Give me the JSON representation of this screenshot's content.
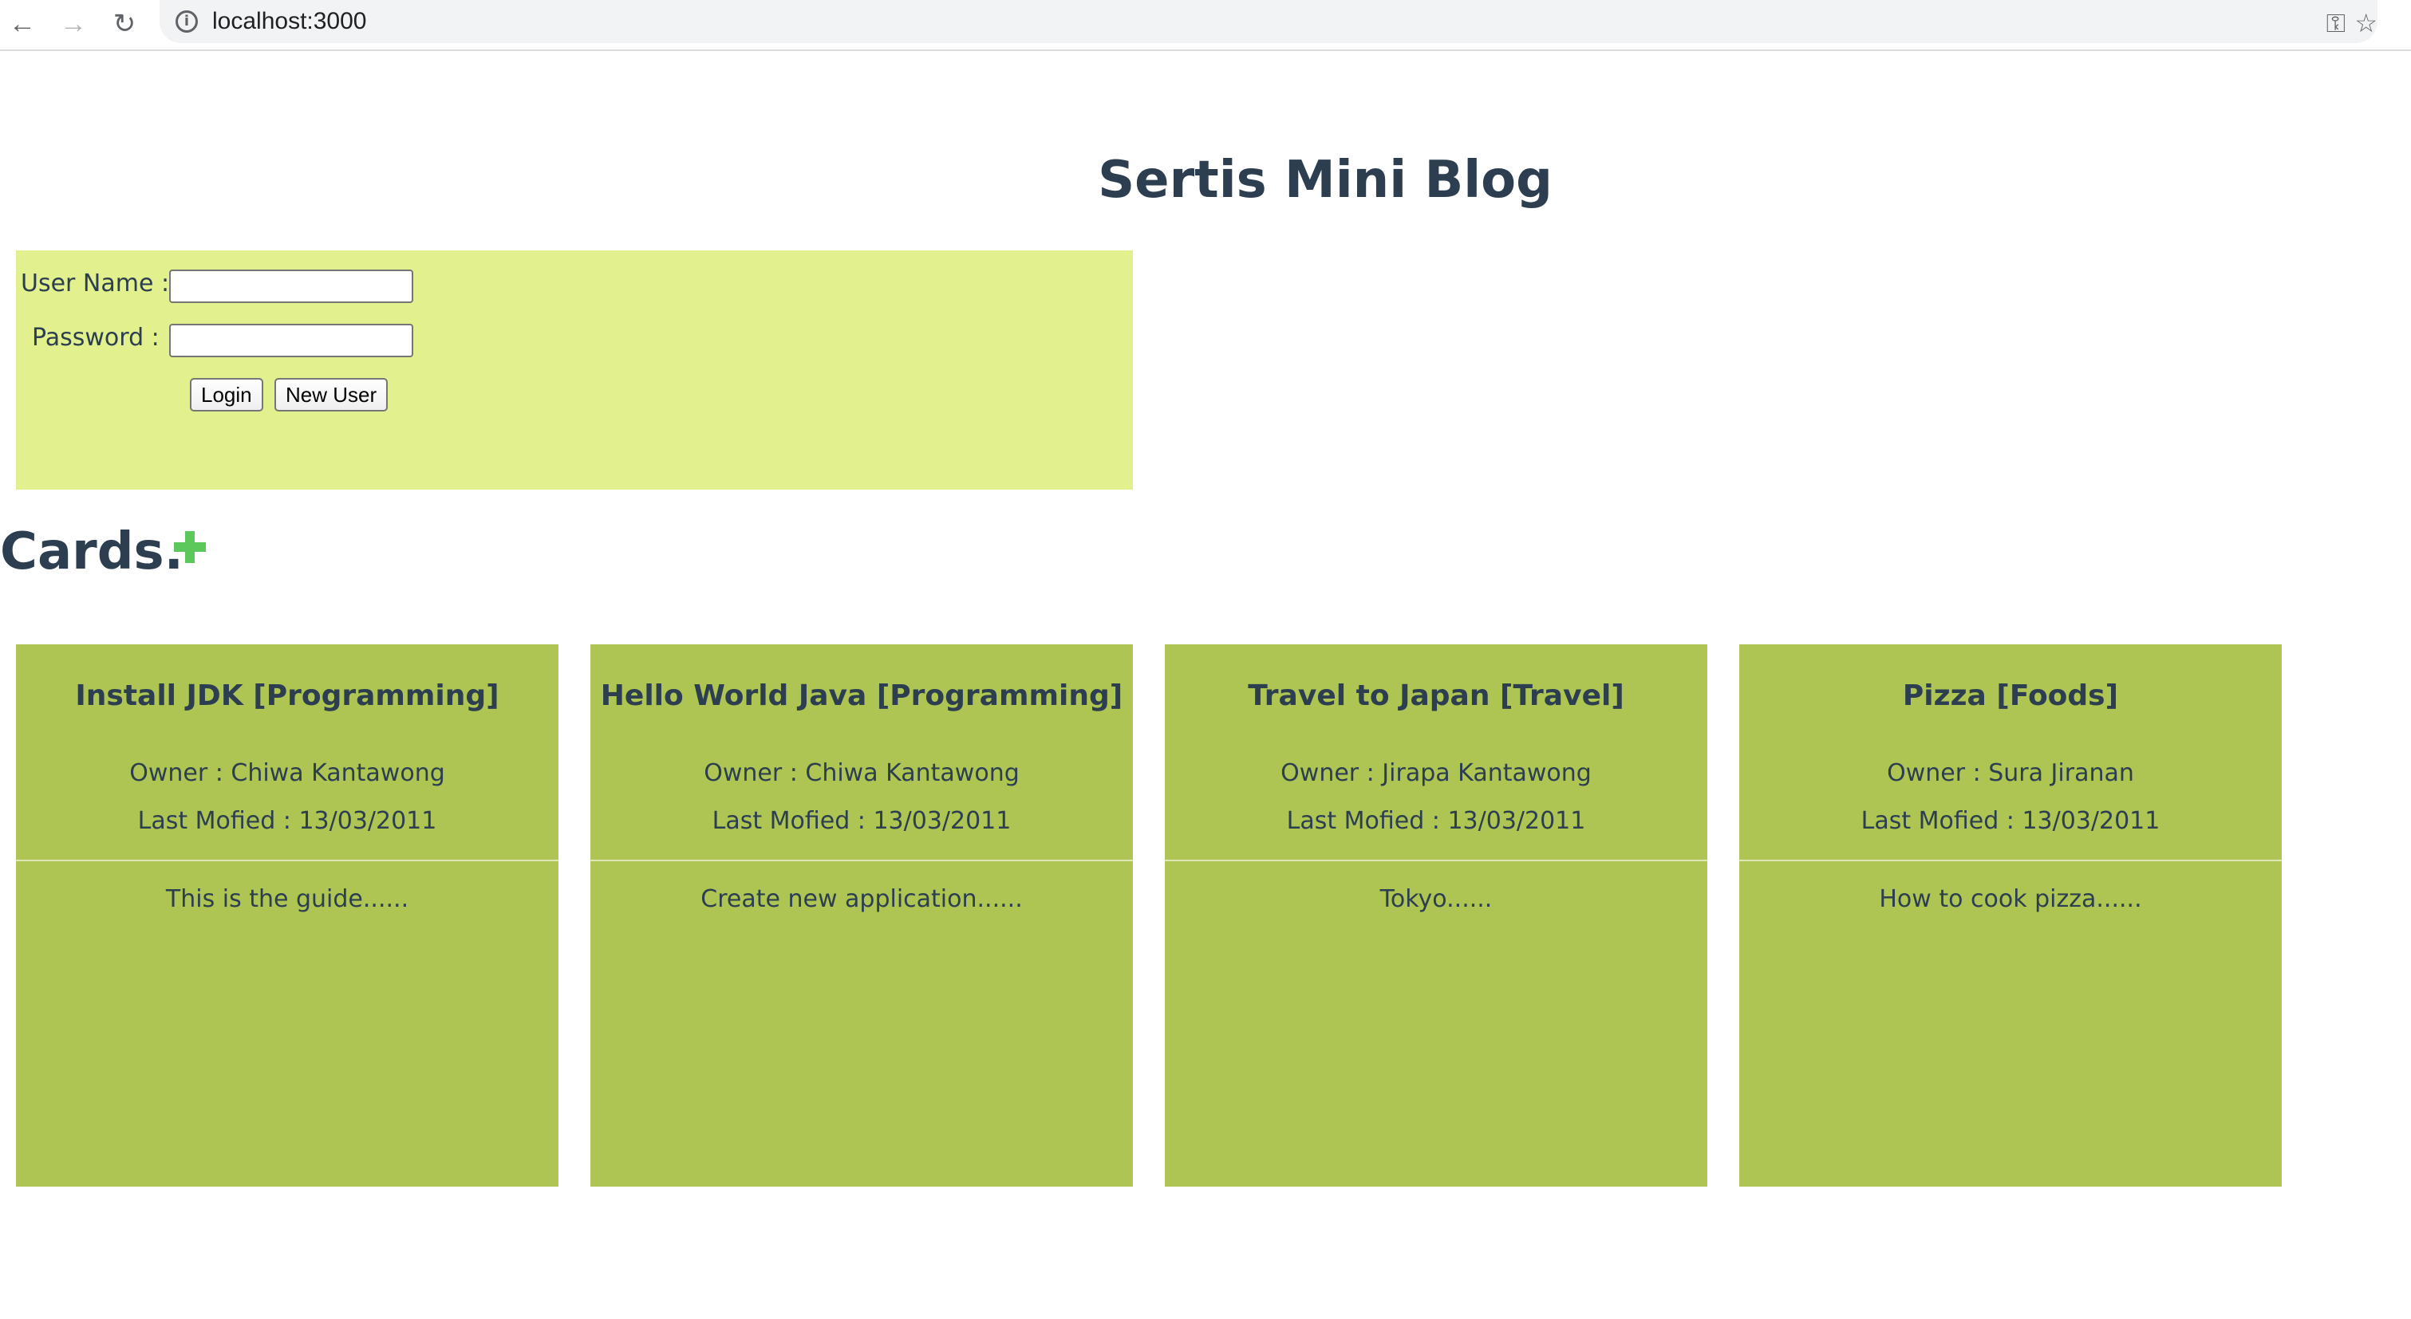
{
  "browser": {
    "url": "localhost:3000",
    "back_icon": "←",
    "forward_icon": "→",
    "reload_icon": "↻",
    "info_icon": "i",
    "key_icon": "⚿",
    "star_icon": "☆"
  },
  "page": {
    "title": "Sertis Mini Blog"
  },
  "login": {
    "username_label": "User Name :",
    "password_label": "Password :",
    "username_value": "",
    "password_value": "",
    "login_button": "Login",
    "new_user_button": "New User"
  },
  "cards_section": {
    "heading": "Cards.",
    "add_icon": "plus-icon",
    "accent_color": "#5cc85c"
  },
  "cards": [
    {
      "title": "Install JDK [Programming]",
      "owner": "Owner : Chiwa Kantawong",
      "modified": "Last Mofied : 13/03/2011",
      "body": "This is the guide......"
    },
    {
      "title": "Hello World Java [Programming]",
      "owner": "Owner : Chiwa Kantawong",
      "modified": "Last Mofied : 13/03/2011",
      "body": "Create new application......"
    },
    {
      "title": "Travel to Japan [Travel]",
      "owner": "Owner : Jirapa Kantawong",
      "modified": "Last Mofied : 13/03/2011",
      "body": "Tokyo......"
    },
    {
      "title": "Pizza [Foods]",
      "owner": "Owner : Sura Jiranan",
      "modified": "Last Mofied : 13/03/2011",
      "body": "How to cook pizza......"
    }
  ],
  "colors": {
    "login_panel": "#e2f18e",
    "card_bg": "#aec553",
    "text": "#2c3e50"
  }
}
